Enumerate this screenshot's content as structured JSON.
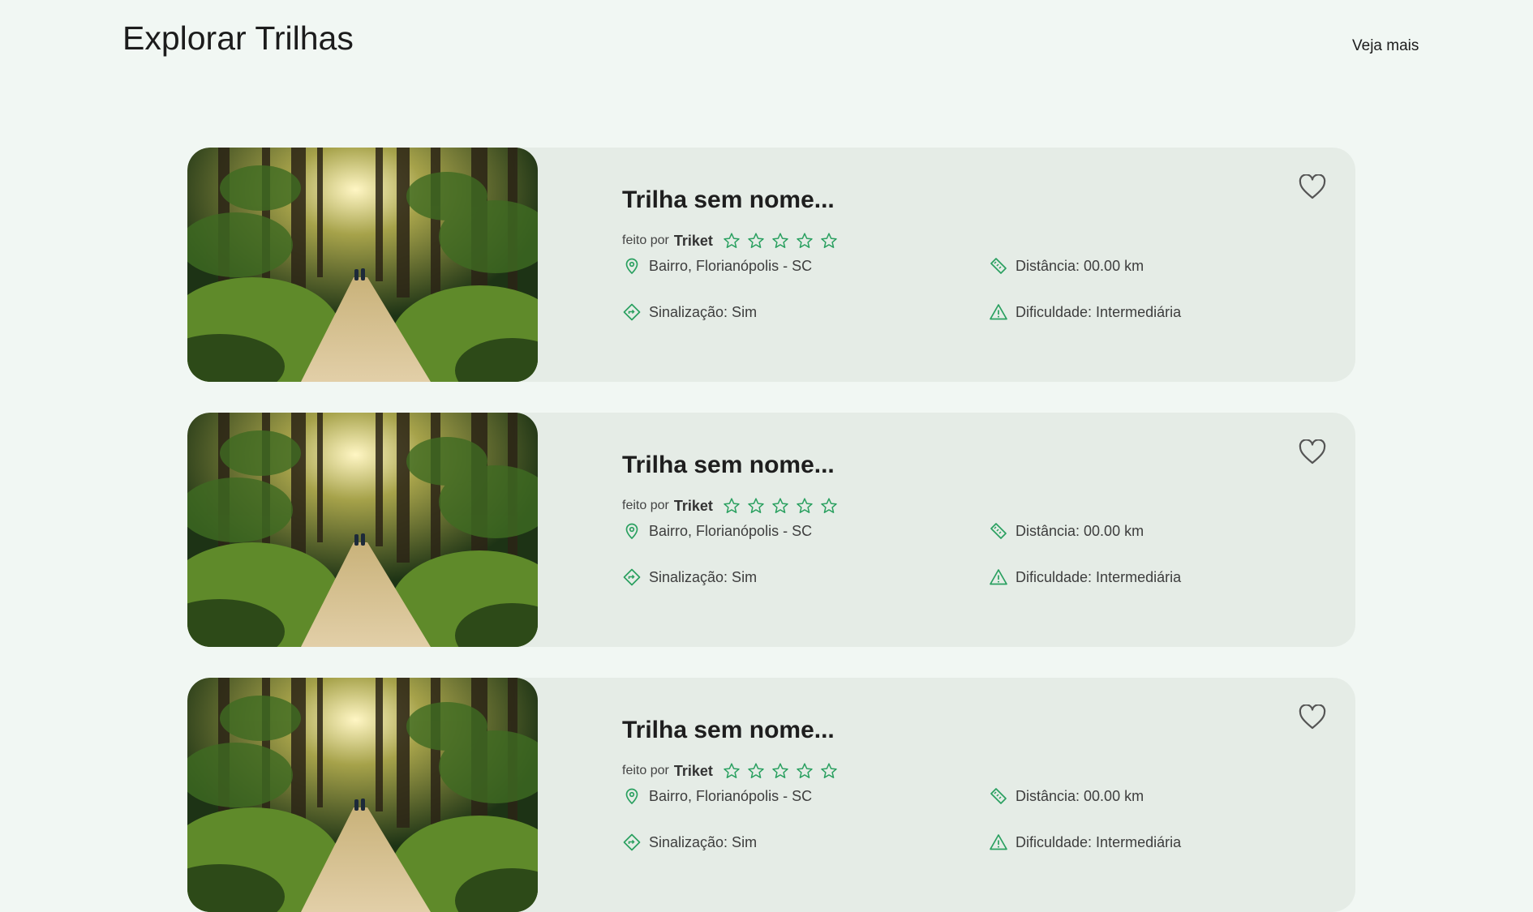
{
  "header": {
    "title": "Explorar Trilhas",
    "see_more": "Veja mais"
  },
  "trails": [
    {
      "title": "Trilha sem nome...",
      "made_by_label": "feito por",
      "author": "Triket",
      "rating": 0,
      "location": "Bairro, Florianópolis - SC",
      "distance": "Distância: 00.00 km",
      "signage": "Sinalização: Sim",
      "difficulty": "Dificuldade: Intermediária"
    },
    {
      "title": "Trilha sem nome...",
      "made_by_label": "feito por",
      "author": "Triket",
      "rating": 0,
      "location": "Bairro, Florianópolis - SC",
      "distance": "Distância: 00.00 km",
      "signage": "Sinalização: Sim",
      "difficulty": "Dificuldade: Intermediária"
    },
    {
      "title": "Trilha sem nome...",
      "made_by_label": "feito por",
      "author": "Triket",
      "rating": 0,
      "location": "Bairro, Florianópolis - SC",
      "distance": "Distância: 00.00 km",
      "signage": "Sinalização: Sim",
      "difficulty": "Dificuldade: Intermediária"
    }
  ],
  "colors": {
    "accent": "#2aa060",
    "background": "#f1f7f3",
    "card": "#e5ece6"
  },
  "icons": [
    "map-pin-icon",
    "ruler-icon",
    "signpost-icon",
    "warning-icon",
    "heart-icon",
    "star-icon"
  ]
}
